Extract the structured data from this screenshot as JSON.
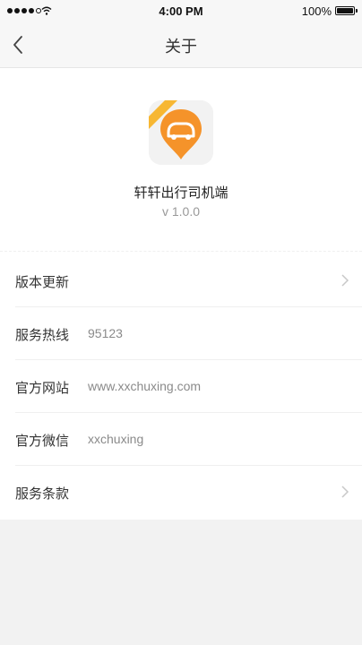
{
  "status_bar": {
    "time": "4:00 PM",
    "battery": "100%"
  },
  "nav": {
    "title": "关于"
  },
  "app": {
    "name": "轩轩出行司机端",
    "version": "v 1.0.0",
    "brand_color": "#f5932a"
  },
  "list": {
    "items": [
      {
        "label": "版本更新",
        "value": ""
      },
      {
        "label": "服务热线",
        "value": "95123"
      },
      {
        "label": "官方网站",
        "value": "www.xxchuxing.com"
      },
      {
        "label": "官方微信",
        "value": "xxchuxing"
      },
      {
        "label": "服务条款",
        "value": ""
      }
    ]
  }
}
